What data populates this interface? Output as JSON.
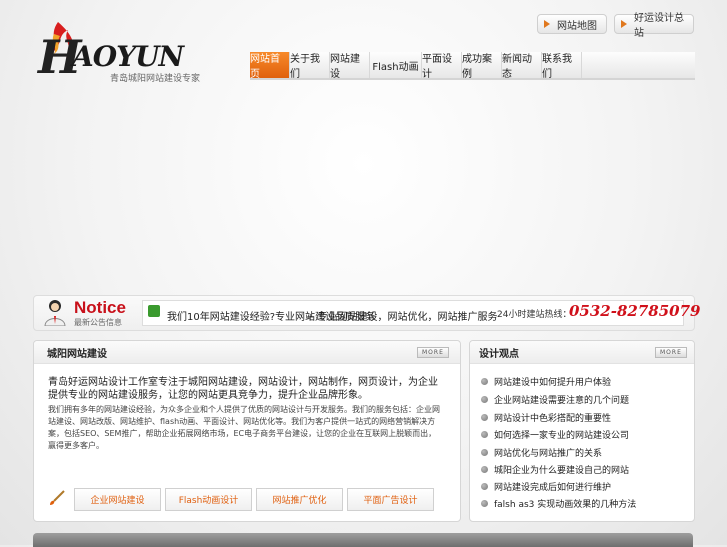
{
  "logo": {
    "text": "HAOYUN",
    "tagline": "青岛城阳网站建设专家"
  },
  "top_links": [
    {
      "label": "网站地图"
    },
    {
      "label": "好运设计总站"
    }
  ],
  "nav": [
    {
      "label": "网站首页",
      "active": true
    },
    {
      "label": "关于我们"
    },
    {
      "label": "网站建设"
    },
    {
      "label": "Flash动画"
    },
    {
      "label": "平面设计"
    },
    {
      "label": "成功案例"
    },
    {
      "label": "新闻动态"
    },
    {
      "label": "联系我们"
    }
  ],
  "notice": {
    "title": "Notice",
    "subtitle": "最新公告信息",
    "items": [
      "我们10年网站建设经验?专业网站建设品质服务",
      "+ 专业网站建设，网站优化，网站推广服务"
    ],
    "hotline_label": "24小时建站热线：",
    "hotline": "0532-82785079"
  },
  "panel_left": {
    "title": "城阳网站建设",
    "more": "MORE",
    "intro": "青岛好运网站设计工作室专注于城阳网站建设，网站设计，网站制作，网页设计，为企业提供专业的网站建设服务，让您的网站更具竞争力，提升企业品牌形象。",
    "body": "我们拥有多年的网站建设经验，为众多企业和个人提供了优质的网站设计与开发服务。我们的服务包括：企业网站建设、网站改版、网站维护、flash动画、平面设计、网站优化等。我们为客户提供一站式的网络营销解决方案，包括SEO、SEM推广，帮助企业拓展网络市场，EC电子商务平台建设，让您的企业在互联网上脱颖而出，赢得更多客户。",
    "buttons": [
      "企业网站建设",
      "Flash动画设计",
      "网站推广优化",
      "平面广告设计"
    ]
  },
  "panel_right": {
    "title": "设计观点",
    "more": "MORE",
    "items": [
      "网站建设中如何提升用户体验",
      "企业网站建设需要注意的几个问题",
      "网站设计中色彩搭配的重要性",
      "如何选择一家专业的网站建设公司",
      "网站优化与网站推广的关系",
      "城阳企业为什么要建设自己的网站",
      "网站建设完成后如何进行维护",
      "falsh as3 实现动画效果的几种方法"
    ]
  },
  "colors": {
    "accent": "#e0600c",
    "notice_red": "#c8101a",
    "hotline_red": "#d0101a"
  }
}
